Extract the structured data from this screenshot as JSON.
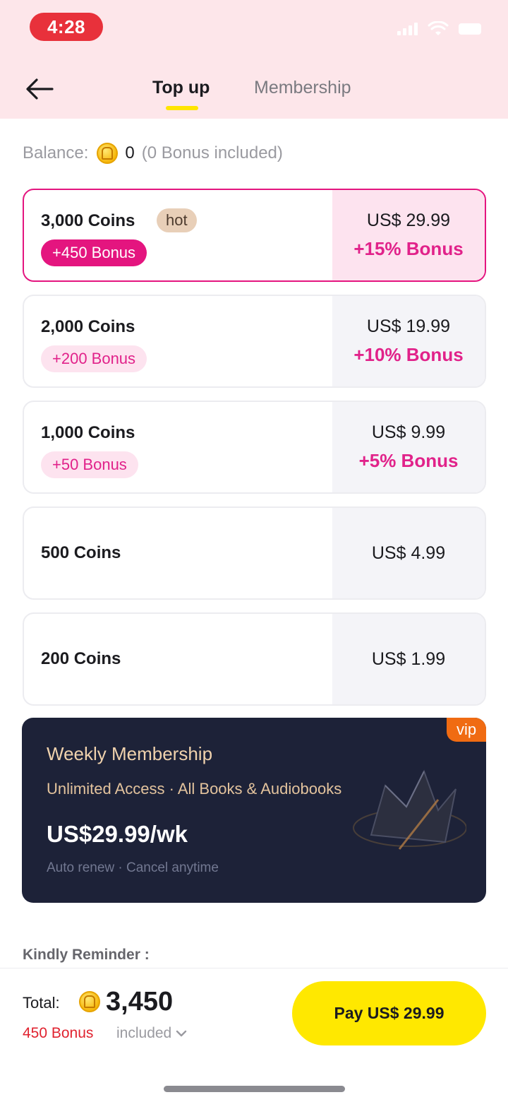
{
  "status_bar": {
    "time": "4:28"
  },
  "header": {
    "tabs": [
      {
        "label": "Top up",
        "active": true
      },
      {
        "label": "Membership",
        "active": false
      }
    ]
  },
  "balance": {
    "label": "Balance:",
    "value": "0",
    "note": "(0 Bonus included)"
  },
  "packages": [
    {
      "coins": "3,000 Coins",
      "badge": "hot",
      "bonus": "+450 Bonus",
      "price": "US$ 29.99",
      "bonus_pct": "+15% Bonus",
      "selected": true
    },
    {
      "coins": "2,000 Coins",
      "bonus": "+200 Bonus",
      "price": "US$ 19.99",
      "bonus_pct": "+10% Bonus",
      "selected": false
    },
    {
      "coins": "1,000 Coins",
      "bonus": "+50 Bonus",
      "price": "US$ 9.99",
      "bonus_pct": "+5% Bonus",
      "selected": false
    },
    {
      "coins": "500 Coins",
      "price": "US$ 4.99",
      "selected": false
    },
    {
      "coins": "200 Coins",
      "price": "US$ 1.99",
      "selected": false
    }
  ],
  "membership": {
    "badge": "vip",
    "title": "Weekly Membership",
    "subtitle": "Unlimited Access · All Books & Audiobooks",
    "price": "US$29.99/wk",
    "note": "Auto renew · Cancel anytime"
  },
  "reminder": {
    "title": "Kindly Reminder :"
  },
  "footer": {
    "total_label": "Total:",
    "total_value": "3,450",
    "bonus_text": "450 Bonus",
    "included_text": "included",
    "pay_label": "Pay US$ 29.99"
  },
  "colors": {
    "accent_pink": "#e4157f",
    "header_bg": "#fde6ea",
    "pay_button": "#ffe800",
    "membership_bg": "#1d2238",
    "vip_badge": "#f06b12"
  }
}
